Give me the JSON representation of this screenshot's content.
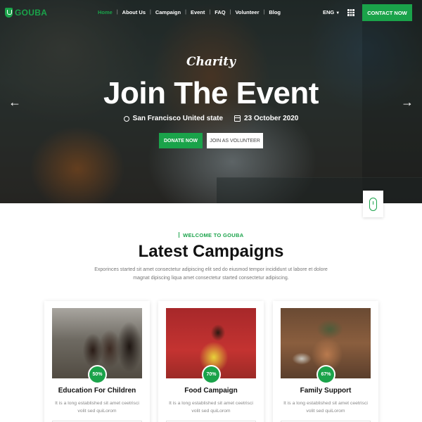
{
  "brand": {
    "name": "GOUBA",
    "color": "#1aa34a",
    "logo_icon": "shield-icon"
  },
  "nav": {
    "items": [
      {
        "label": "Home",
        "active": true
      },
      {
        "label": "About Us"
      },
      {
        "label": "Campaign"
      },
      {
        "label": "Event"
      },
      {
        "label": "FAQ"
      },
      {
        "label": "Volunteer"
      },
      {
        "label": "Blog"
      }
    ],
    "language": "ENG",
    "apps_icon": "grid-icon",
    "contact_label": "CONTACT NOW"
  },
  "hero": {
    "tagline": "Charity",
    "title": "Join The Event",
    "location": "San Francisco United state",
    "date": "23 October 2020",
    "donate_label": "DONATE NOW",
    "volunteer_label": "JOIN AS VOLUNTEER",
    "prev_icon": "arrow-left-icon",
    "next_icon": "arrow-right-icon"
  },
  "section": {
    "welcome": "WELCOME TO GOUBA",
    "title": "Latest Campaigns",
    "description": "Exporinces started sit amet consectetur adipiscing elit sed do eiusmod tempor incididunt ut labore et dolore magnat dipiscing liqua amet consectetur started consectetur adipiscing."
  },
  "campaigns": [
    {
      "title": "Education For Children",
      "progress": "50%",
      "text": "It is a long established sit amet ceetrisci volit sed quiLorom"
    },
    {
      "title": "Food Campaign",
      "progress": "70%",
      "text": "It is a long established sit amet ceetrisci volit sed quiLorom"
    },
    {
      "title": "Family Support",
      "progress": "67%",
      "text": "It is a long established sit amet ceetrisci volit sed quiLorom"
    }
  ]
}
